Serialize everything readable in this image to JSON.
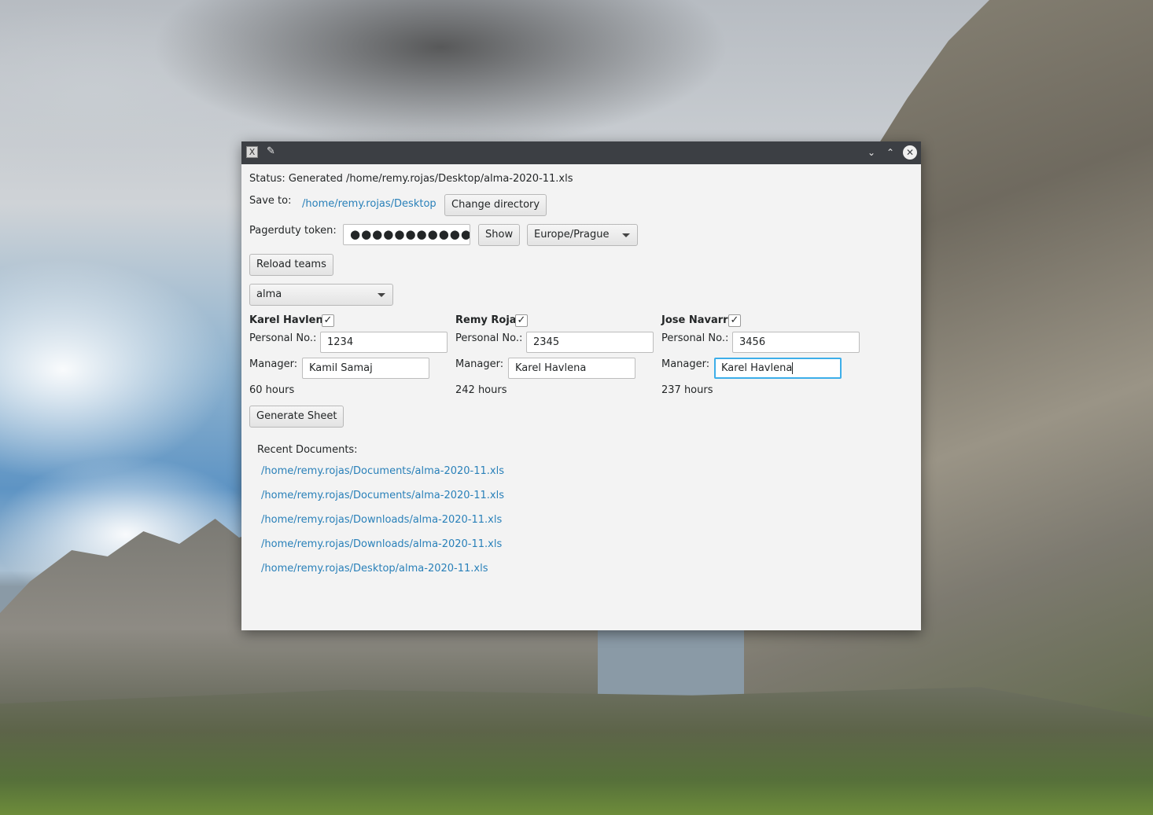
{
  "window": {
    "status_text": "Status: Generated /home/remy.rojas/Desktop/alma-2020-11.xls",
    "save_to_label": "Save to:",
    "save_to_path": "/home/remy.rojas/Desktop",
    "change_directory_label": "Change directory",
    "token_label": "Pagerduty token:",
    "token_masked": "●●●●●●●●●●●●●",
    "show_label": "Show",
    "timezone_value": "Europe/Prague",
    "reload_teams_label": "Reload teams",
    "team_value": "alma",
    "personal_no_label": "Personal No.:",
    "manager_label": "Manager:",
    "people": [
      {
        "name": "Karel Havlena",
        "checked": true,
        "personal_no": "1234",
        "manager": "Kamil Samaj",
        "hours": "60 hours"
      },
      {
        "name": "Remy Rojas",
        "checked": true,
        "personal_no": "2345",
        "manager": "Karel Havlena",
        "hours": "242 hours"
      },
      {
        "name": "Jose Navarro",
        "checked": true,
        "personal_no": "3456",
        "manager": "Karel Havlena",
        "hours": "237 hours"
      }
    ],
    "generate_sheet_label": "Generate Sheet",
    "recent_documents_label": "Recent Documents:",
    "recent_documents": [
      "/home/remy.rojas/Documents/alma-2020-11.xls",
      "/home/remy.rojas/Documents/alma-2020-11.xls",
      "/home/remy.rojas/Downloads/alma-2020-11.xls",
      "/home/remy.rojas/Downloads/alma-2020-11.xls",
      "/home/remy.rojas/Desktop/alma-2020-11.xls"
    ]
  },
  "icons": {
    "app": "x-app-icon",
    "pin": "pin-icon",
    "minimize": "chevron-down-icon",
    "maximize": "chevron-up-icon",
    "close": "close-icon",
    "check": "checkmark-icon"
  },
  "colors": {
    "link": "#2980b9",
    "focus": "#3daee9",
    "titlebar": "#3c3f44",
    "window_bg": "#f3f3f3"
  }
}
